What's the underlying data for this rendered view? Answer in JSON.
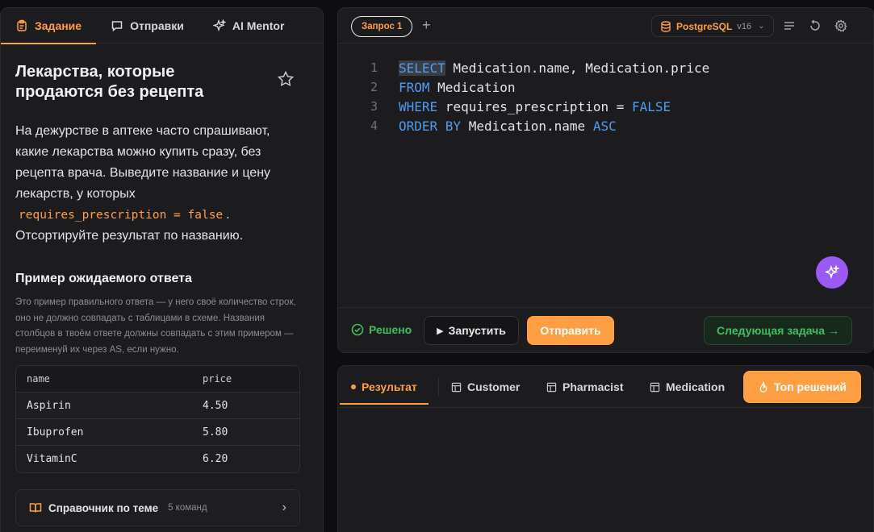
{
  "left_tabs": [
    {
      "label": "Задание",
      "icon": "clipboard-icon",
      "active": true
    },
    {
      "label": "Отправки",
      "icon": "message-icon",
      "active": false
    },
    {
      "label": "AI Mentor",
      "icon": "sparkle-icon",
      "active": false
    }
  ],
  "task": {
    "title": "Лекарства, которые продаются без рецепта",
    "description_before": "На дежурстве в аптеке часто спрашивают, какие лекарства можно купить сразу, без рецепта врача. Выведите название и цену лекарств, у которых",
    "description_code": "requires_prescription = false",
    "description_after": ". Отсортируйте результат по названию."
  },
  "example": {
    "title": "Пример ожидаемого ответа",
    "note": "Это пример правильного ответа — у него своё количество строк, оно не должно совпадать с таблицами в схеме. Названия столбцов в твоём ответе должны совпадать с этим примером — переименуй их через AS, если нужно.",
    "columns": [
      "name",
      "price"
    ],
    "rows": [
      [
        "Aspirin",
        "4.50"
      ],
      [
        "Ibuprofen",
        "5.80"
      ],
      [
        "VitaminC",
        "6.20"
      ]
    ]
  },
  "reference": {
    "label": "Справочник по теме",
    "count": "5 команд"
  },
  "editor": {
    "query_tab": "Запрос 1",
    "db_name": "PostgreSQL",
    "db_version": "v16",
    "lines": [
      {
        "num": "1",
        "kw": "SELECT",
        "rest": " Medication.name, Medication.price"
      },
      {
        "num": "2",
        "kw": "FROM",
        "rest": " Medication"
      },
      {
        "num": "3",
        "kw": "WHERE",
        "rest": " requires_prescription = ",
        "kw2": "FALSE"
      },
      {
        "num": "4",
        "kw": "ORDER BY",
        "rest": " Medication.name ",
        "kw2": "ASC"
      }
    ]
  },
  "actions": {
    "solved": "Решено",
    "run": "Запустить",
    "submit": "Отправить",
    "next": "Следующая задача →"
  },
  "results_tabs": [
    {
      "label": "Результат",
      "active": true
    },
    {
      "label": "Customer",
      "icon": "table-icon"
    },
    {
      "label": "Pharmacist",
      "icon": "table-icon"
    },
    {
      "label": "Medication",
      "icon": "table-icon"
    }
  ],
  "top_solutions": "Топ решений",
  "colors": {
    "accent": "#ff9f43",
    "success": "#3fbf5f",
    "keyword": "#4f9cf0",
    "ai": "#9b59f5"
  }
}
